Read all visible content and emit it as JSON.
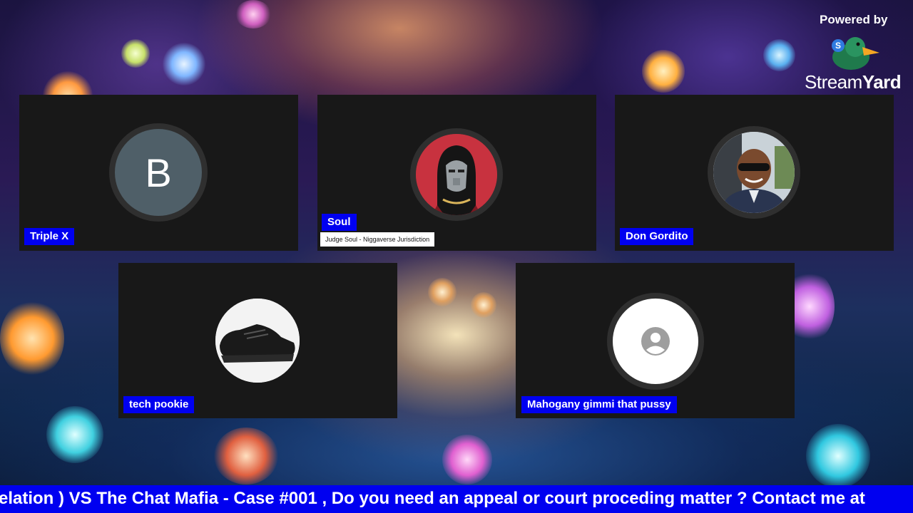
{
  "branding": {
    "powered_by": "Powered by",
    "logo_word_light": "Stream",
    "logo_word_bold": "Yard",
    "logo_badge": "S"
  },
  "participants": [
    {
      "name": "Triple X",
      "avatar_type": "initial",
      "initial": "B",
      "avatar_color": "#4f5f68"
    },
    {
      "name": "Soul",
      "subtitle": "Judge Soul - Niggaverse Jurisdiction",
      "avatar_type": "masked-figure-icon",
      "avatar_color": "#c8323f"
    },
    {
      "name": "Don Gordito",
      "avatar_type": "person-photo"
    },
    {
      "name": "tech pookie",
      "avatar_type": "sneaker-photo"
    },
    {
      "name": "Mahogany gimmi that pussy",
      "avatar_type": "default-user-icon"
    }
  ],
  "ticker": {
    "text": "elation ) VS The Chat Mafia - Case #001 , Do you need an appeal or court proceding matter ? Contact me at"
  },
  "colors": {
    "name_tag_bg": "#0000f0",
    "tile_bg": "#181818",
    "ticker_bg": "#0000f0"
  }
}
